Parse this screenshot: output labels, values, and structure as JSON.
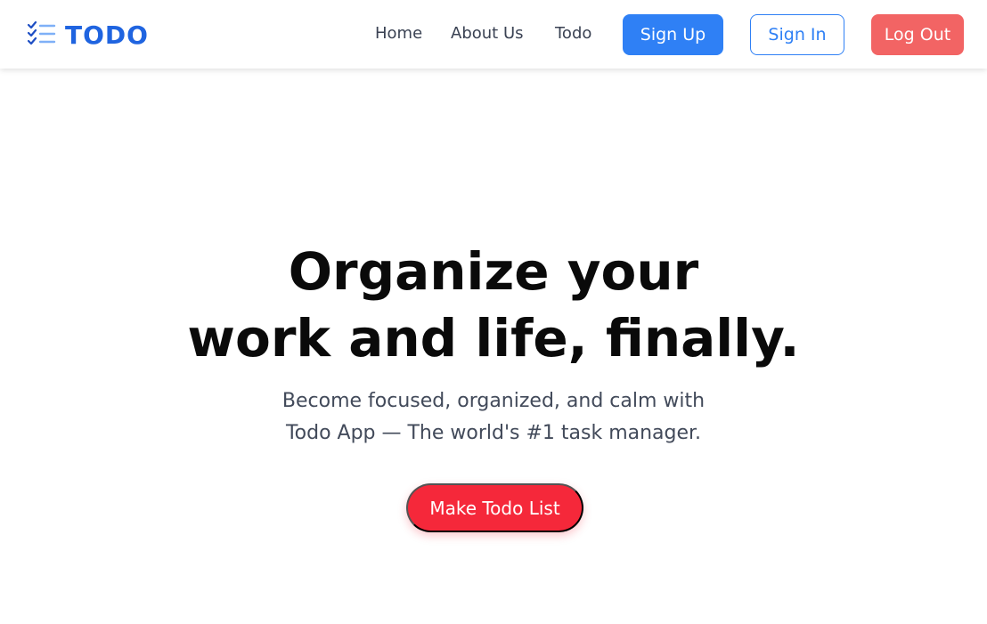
{
  "brand": {
    "name": "TODO",
    "icon": "checklist-icon",
    "color": "#1f64e0"
  },
  "nav": {
    "links": [
      {
        "label": "Home"
      },
      {
        "label": "About Us"
      },
      {
        "label": "Todo"
      }
    ],
    "signup_label": "Sign Up",
    "signin_label": "Sign In",
    "logout_label": "Log Out"
  },
  "hero": {
    "title_line1": "Organize your",
    "title_line2": "work and life, finally.",
    "subtitle_line1": "Become focused, organized, and calm with",
    "subtitle_line2": "Todo App — The world's #1 task manager.",
    "cta_label": "Make Todo List"
  },
  "colors": {
    "primary": "#2f80f5",
    "danger_soft": "#f26464",
    "cta": "#f5283a"
  }
}
